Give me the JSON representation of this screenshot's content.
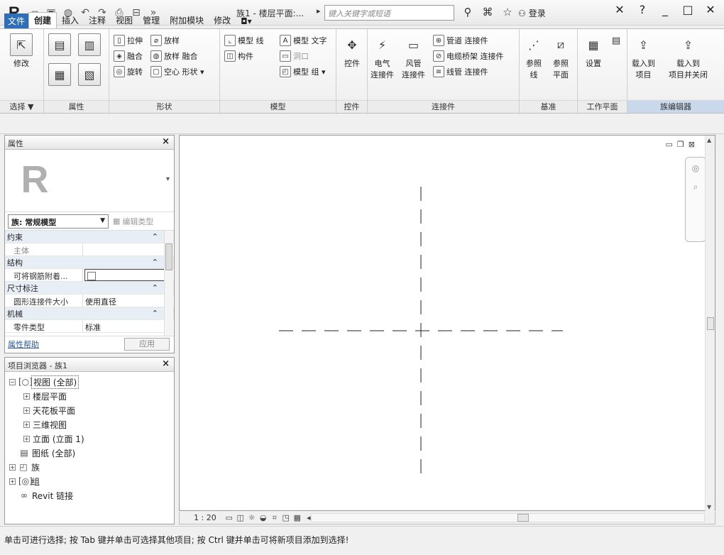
{
  "app": {
    "title": "族1 - 楼层平面:...",
    "search_placeholder": "键入关键字或短语",
    "login": "登录"
  },
  "tabs": [
    {
      "label": "文件"
    },
    {
      "label": "创建"
    },
    {
      "label": "插入"
    },
    {
      "label": "注释"
    },
    {
      "label": "视图"
    },
    {
      "label": "管理"
    },
    {
      "label": "附加模块"
    },
    {
      "label": "修改"
    }
  ],
  "ribbon": {
    "select": {
      "modify": "修改",
      "label": "选择 ▼"
    },
    "properties": {
      "label": "属性"
    },
    "shape": {
      "extrude": "拉伸",
      "blend": "融合",
      "revolve": "旋转",
      "sweep": "放样",
      "swept_blend": "放样 融合",
      "void": "空心 形状 ▾",
      "label": "形状"
    },
    "model": {
      "model_line": "模型 线",
      "model_text": "模型 文字",
      "component": "构件",
      "opening": "洞口",
      "model_group": "模型 组 ▾",
      "label": "模型"
    },
    "control": {
      "control": "控件",
      "label": "控件"
    },
    "connectors": {
      "electrical_1": "电气",
      "electrical_2": "连接件",
      "duct_1": "风管",
      "duct_2": "连接件",
      "pipe": "管道 连接件",
      "cable_tray": "电缆桥架 连接件",
      "conduit": "线管 连接件",
      "label": "连接件"
    },
    "datum": {
      "ref_line_1": "参照",
      "ref_line_2": "线",
      "ref_plane_1": "参照",
      "ref_plane_2": "平面",
      "label": "基准"
    },
    "workplane": {
      "set": "设置",
      "label": "工作平面"
    },
    "family_editor": {
      "load_project_1": "载入到",
      "load_project_2": "项目",
      "load_close_1": "载入到",
      "load_close_2": "项目并关闭",
      "label": "族编辑器"
    }
  },
  "properties": {
    "title": "属性",
    "type_value": "族: 常规模型",
    "edit_type": "编辑类型",
    "rows": [
      {
        "kind": "group",
        "label": "约束"
      },
      {
        "kind": "row",
        "key": "主体",
        "value": ""
      },
      {
        "kind": "group",
        "label": "结构"
      },
      {
        "kind": "row",
        "key": "可将钢筋附着...",
        "value": ""
      },
      {
        "kind": "group",
        "label": "尺寸标注"
      },
      {
        "kind": "row",
        "key": "圆形连接件大小",
        "value": "使用直径"
      },
      {
        "kind": "group",
        "label": "机械"
      },
      {
        "kind": "row",
        "key": "零件类型",
        "value": "标准"
      }
    ],
    "help_link": "属性帮助",
    "apply": "应用"
  },
  "browser": {
    "title": "项目浏览器 - 族1",
    "views_all": "视图 (全部)",
    "floor_plans": "楼层平面",
    "ceiling_plans": "天花板平面",
    "views_3d": "三维视图",
    "elevations": "立面 (立面 1)",
    "sheets": "图纸 (全部)",
    "families": "族",
    "groups": "组",
    "revit_links": "Revit 链接"
  },
  "viewbar": {
    "scale": "1 : 20"
  },
  "statusbar": {
    "text": "单击可进行选择; 按 Tab 键并单击可选择其他项目; 按 Ctrl 键并单击可将新项目添加到选择!"
  }
}
